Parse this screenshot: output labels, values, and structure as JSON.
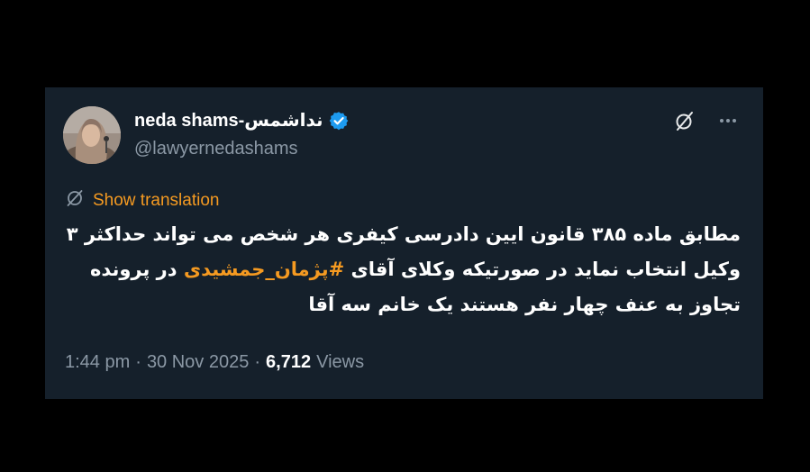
{
  "tweet": {
    "author": {
      "display_name": "neda shams-نداشمس",
      "handle": "@lawyernedashams",
      "verified": true,
      "verified_color": "#1d9bf0"
    },
    "actions": {
      "grok_icon": "grok-slash-icon",
      "more_icon": "more-options-icon"
    },
    "translation": {
      "label": "Show translation",
      "icon": "translate-icon",
      "color": "#f59a21"
    },
    "text_before_hashtag": "مطابق ماده ۳۸۵ قانون ایین دادرسی کیفری هر شخص می تواند حداکثر ۳ وکیل انتخاب نماید در صورتیکه وکلای آقای ",
    "hashtag": "#پژمان_جمشیدی",
    "text_after_hashtag": " در پرونده تجاوز به عنف چهار نفر هستند یک خانم سه آقا",
    "meta": {
      "time": "1:44 pm",
      "separator": "·",
      "date": "30 Nov 2025",
      "views_count": "6,712",
      "views_label": "Views"
    }
  },
  "colors": {
    "background": "#000000",
    "card": "#15202b",
    "accent": "#f59a21",
    "secondary_text": "#8b98a5"
  }
}
